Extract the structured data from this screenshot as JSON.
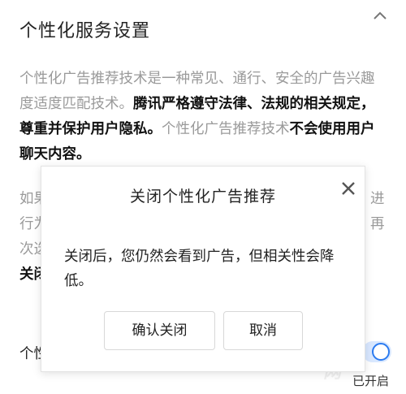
{
  "header": {
    "title": "个性化服务设置"
  },
  "description": {
    "part1": "个性化广告推荐技术是一种常见、通行、安全的广告兴趣度适度匹配技术。",
    "part2_bold": "腾讯严格遵守法律、法规的相关规定，尊重并保护用户隐私。",
    "part3": "个性化广告推荐技术",
    "part4_bold": "不会使用用户聊天内容。"
  },
  "behind": {
    "line1_start": "如果",
    "line1_end": "进",
    "line2_start": "行为",
    "line2_end": "再",
    "line3_start": "次选",
    "line4_start_bold": "关闭",
    "toggle_label": "个性",
    "status": "已开启"
  },
  "modal": {
    "title": "关闭个性化广告推荐",
    "body": "关闭后，您仍然会看到广告，但相关性会降低。",
    "confirm_label": "确认关闭",
    "cancel_label": "取消"
  },
  "colors": {
    "accent": "#2b7bf0",
    "muted_text": "#9a9a9a"
  },
  "icons": {
    "collapse": "chevron-up-icon",
    "close": "close-icon"
  }
}
